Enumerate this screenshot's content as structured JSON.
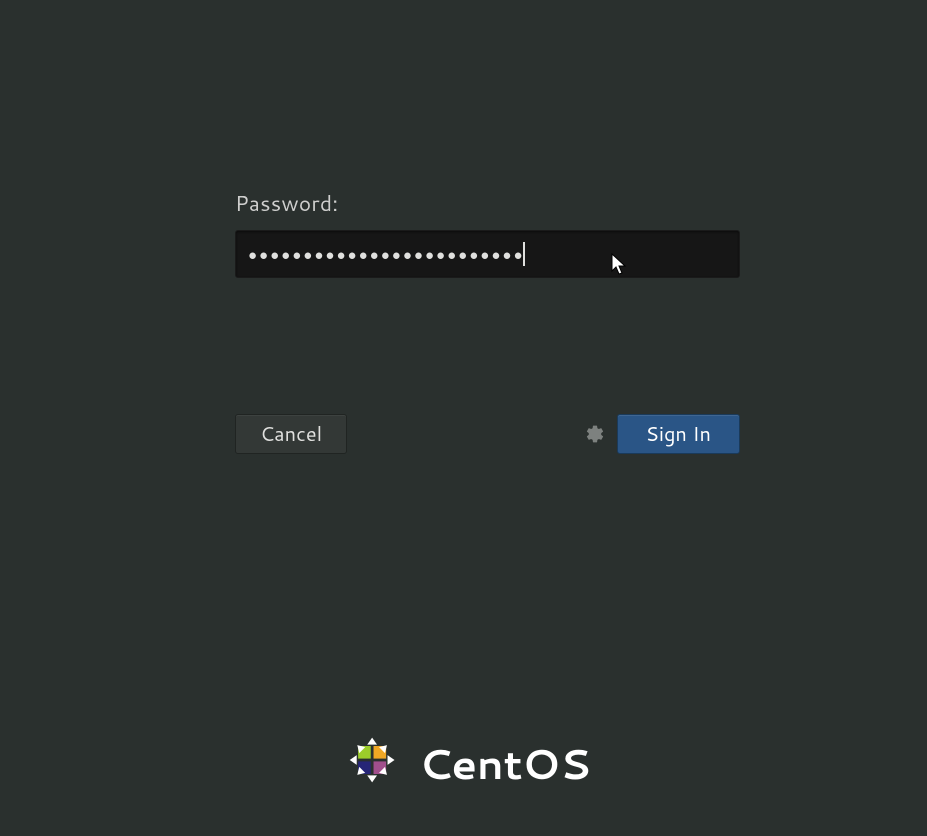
{
  "login": {
    "password_label": "Password:",
    "password_mask": "●●●●●●●●●●●●●●●●●●●●●●●●●",
    "cancel_label": "Cancel",
    "signin_label": "Sign In"
  },
  "branding": {
    "product_name": "CentOS"
  }
}
